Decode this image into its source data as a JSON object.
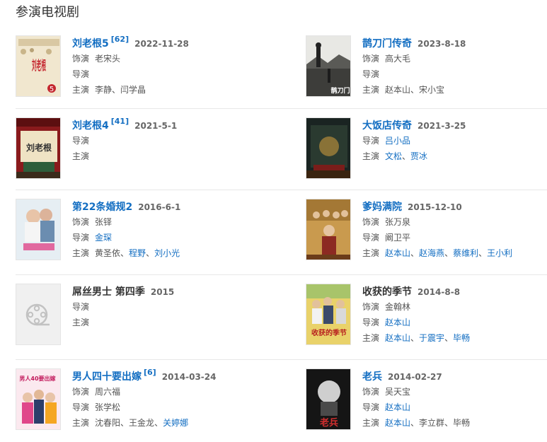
{
  "section_title": "参演电视剧",
  "labels": {
    "role": "饰演",
    "director": "导演",
    "cast": "主演"
  },
  "cards": [
    {
      "title": "刘老根5",
      "sup": "[62]",
      "date": "2022-11-28",
      "role": "老宋头",
      "director": [],
      "cast": [
        "李静",
        "闫学晶"
      ]
    },
    {
      "title": "鹊刀门传奇",
      "sup": "",
      "date": "2023-8-18",
      "role": "高大毛",
      "director": [],
      "cast": [
        "赵本山",
        "宋小宝"
      ]
    },
    {
      "title": "刘老根4",
      "sup": "[41]",
      "date": "2021-5-1",
      "role": "",
      "director": [],
      "cast": []
    },
    {
      "title": "大饭店传奇",
      "sup": "",
      "date": "2021-3-25",
      "role": "",
      "director": [
        "吕小品"
      ],
      "cast": [
        "文松",
        "贾冰"
      ]
    },
    {
      "title": "第22条婚规2",
      "sup": "",
      "date": "2016-6-1",
      "role": "张铎",
      "director": [
        "金琛"
      ],
      "cast": [
        "黄圣依",
        "程野",
        "刘小光"
      ]
    },
    {
      "title": "爹妈满院",
      "sup": "",
      "date": "2015-12-10",
      "role": "张万泉",
      "director": [
        "阚卫平"
      ],
      "cast": [
        "赵本山",
        "赵海燕",
        "蔡维利",
        "王小利"
      ]
    },
    {
      "title": "屌丝男士 第四季",
      "sup": "",
      "date": "2015",
      "role": "",
      "director": [],
      "cast": []
    },
    {
      "title": "收获的季节",
      "sup": "",
      "date": "2014-8-8",
      "role": "金翰林",
      "director": [
        "赵本山"
      ],
      "cast": [
        "赵本山",
        "于震宇",
        "毕畅"
      ]
    },
    {
      "title": "男人四十要出嫁",
      "sup": "[6]",
      "date": "2014-03-24",
      "role": "周六福",
      "director": [
        "张学松"
      ],
      "cast": [
        "沈春阳",
        "王金龙",
        "关婷娜"
      ]
    },
    {
      "title": "老兵",
      "sup": "",
      "date": "2014-02-27",
      "role": "吴天宝",
      "director": [
        "赵本山"
      ],
      "cast": [
        "赵本山",
        "李立群",
        "毕畅"
      ]
    }
  ],
  "poster_texts": {
    "liulaogen5": "刘老根",
    "liulaogen5_num": "5",
    "quedao": "鹊刀门",
    "liulaogen4": "刘老根",
    "harvest": "收获的季节",
    "man40": "男人40要出嫁",
    "laobing": "老兵"
  },
  "colors": {
    "link": "#136ec2",
    "text": "#555555",
    "title": "#333333",
    "divider": "#e8e8e8"
  },
  "icons": {
    "placeholder": "film-reel-icon"
  }
}
